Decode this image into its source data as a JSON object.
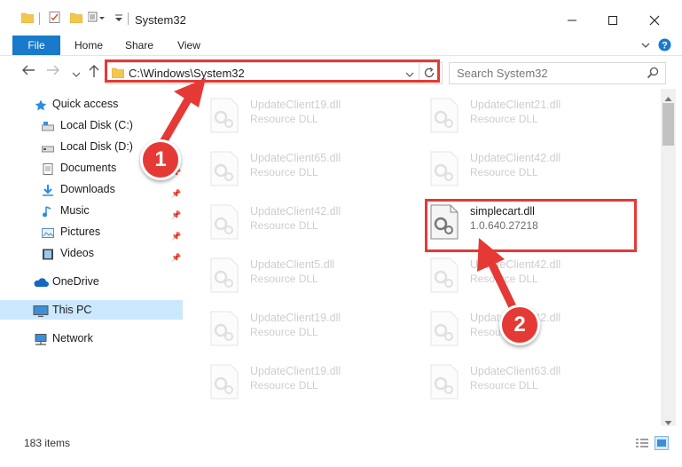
{
  "window": {
    "title": "System32",
    "minimize_icon": "minimize-icon",
    "maximize_icon": "maximize-icon",
    "close_icon": "close-icon"
  },
  "ribbon": {
    "tabs": [
      "File",
      "Home",
      "Share",
      "View"
    ]
  },
  "address_bar": {
    "path": "C:\\Windows\\System32",
    "search_placeholder": "Search System32"
  },
  "sidebar": {
    "items": [
      {
        "label": "Quick access",
        "icon": "star-icon"
      },
      {
        "label": "Local Disk (C:)",
        "icon": "drive-icon"
      },
      {
        "label": "Local Disk (D:)",
        "icon": "drive-icon"
      },
      {
        "label": "Documents",
        "icon": "documents-icon"
      },
      {
        "label": "Downloads",
        "icon": "downloads-icon"
      },
      {
        "label": "Music",
        "icon": "music-icon"
      },
      {
        "label": "Pictures",
        "icon": "pictures-icon"
      },
      {
        "label": "Videos",
        "icon": "videos-icon"
      },
      {
        "label": "OneDrive",
        "icon": "cloud-icon"
      },
      {
        "label": "This PC",
        "icon": "computer-icon"
      },
      {
        "label": "Network",
        "icon": "network-icon"
      }
    ]
  },
  "files": [
    {
      "name": "UpdateClient19.dll",
      "sub": "Resource DLL"
    },
    {
      "name": "UpdateClient21.dll",
      "sub": "Resource DLL"
    },
    {
      "name": "UpdateClient65.dll",
      "sub": "Resource DLL"
    },
    {
      "name": "UpdateClient42.dll",
      "sub": "Resource DLL"
    },
    {
      "name": "UpdateClient42.dll",
      "sub": "Resource DLL"
    },
    {
      "name": "simplecart.dll",
      "sub": "1.0.640.27218"
    },
    {
      "name": "UpdateClient5.dll",
      "sub": "Resource DLL"
    },
    {
      "name": "UpdateClient42.dll",
      "sub": "Resource DLL"
    },
    {
      "name": "UpdateClient19.dll",
      "sub": "Resource DLL"
    },
    {
      "name": "UpdateClient42.dll",
      "sub": "Resource DLL"
    },
    {
      "name": "UpdateClient19.dll",
      "sub": "Resource DLL"
    },
    {
      "name": "UpdateClient63.dll",
      "sub": "Resource DLL"
    }
  ],
  "status": {
    "item_count": "183 items"
  },
  "annotations": {
    "step1": "1",
    "step2": "2",
    "color": "#e53935"
  },
  "colors": {
    "accent": "#1979ca",
    "selected_bg": "#cce8ff"
  }
}
